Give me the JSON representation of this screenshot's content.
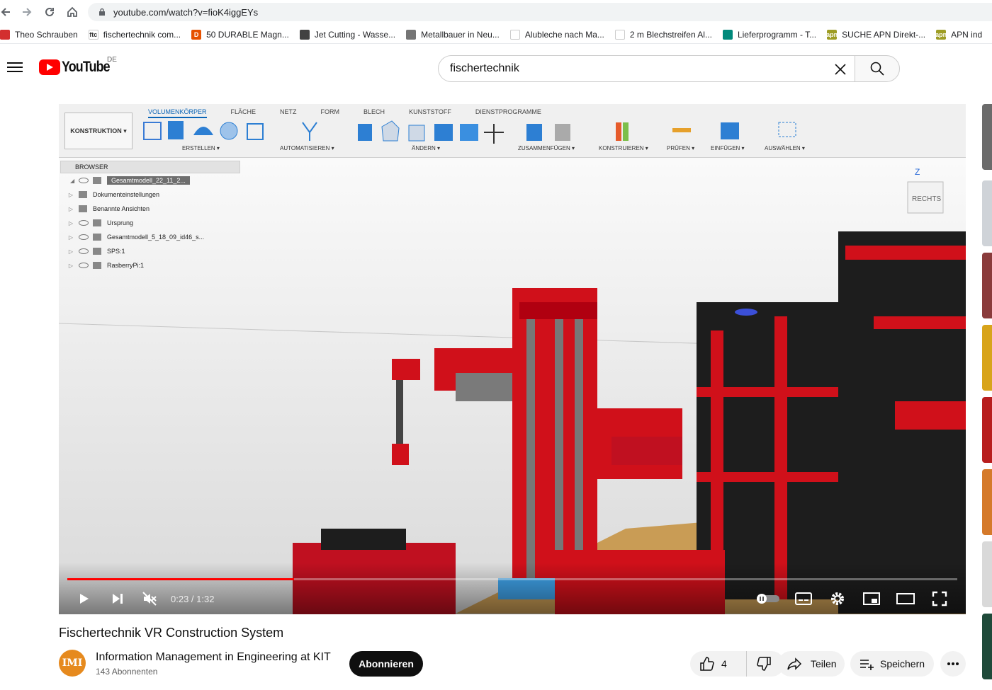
{
  "browser": {
    "url": "youtube.com/watch?v=fioK4iggEYs",
    "bookmarks": [
      {
        "label": "Theo Schrauben",
        "color": "#d32f2f",
        "glyph": ""
      },
      {
        "label": "fischertechnik com...",
        "color": "#ffffff",
        "glyph": "ftc"
      },
      {
        "label": "50 DURABLE Magn...",
        "color": "#e65100",
        "glyph": "D"
      },
      {
        "label": "Jet Cutting - Wasse...",
        "color": "#424242",
        "glyph": ""
      },
      {
        "label": "Metallbauer in Neu...",
        "color": "#757575",
        "glyph": ""
      },
      {
        "label": "Alubleche nach Ma...",
        "color": "#ffffff",
        "glyph": ""
      },
      {
        "label": "2 m Blechstreifen Al...",
        "color": "#ffffff",
        "glyph": ""
      },
      {
        "label": "Lieferprogramm - T...",
        "color": "#00897b",
        "glyph": ""
      },
      {
        "label": "SUCHE APN Direkt-...",
        "color": "#9e9d24",
        "glyph": "apn"
      },
      {
        "label": "APN ind",
        "color": "#9e9d24",
        "glyph": "apn"
      }
    ]
  },
  "header": {
    "logo_text": "YouTube",
    "country": "DE",
    "search_value": "fischertechnik"
  },
  "video": {
    "ribbon_tabs": [
      "VOLUMENKÖRPER",
      "FLÄCHE",
      "NETZ",
      "FORM",
      "BLECH",
      "KUNSTSTOFF",
      "DIENSTPROGRAMME"
    ],
    "mode_button": "KONSTRUKTION ▾",
    "ribbon_groups": [
      "ERSTELLEN ▾",
      "AUTOMATISIEREN ▾",
      "ÄNDERN ▾",
      "ZUSAMMENFÜGEN ▾",
      "KONSTRUIEREN ▾",
      "PRÜFEN ▾",
      "EINFÜGEN ▾",
      "AUSWÄHLEN ▾"
    ],
    "browser_title": "BROWSER",
    "browser_items": [
      "Gesamtmodell_22_11_2...",
      "Dokumenteinstellungen",
      "Benannte Ansichten",
      "Ursprung",
      "Gesamtmodell_5_18_09_id46_s...",
      "SPS:1",
      "RasberryPi:1"
    ],
    "viewcube_label": "RECHTS",
    "viewcube_axis": "Z",
    "time": "0:23 / 1:32",
    "progress": 0.255,
    "title": "Fischertechnik VR Construction System"
  },
  "channel": {
    "name": "Information Management in Engineering at KIT",
    "subs": "143 Abonnenten",
    "avatar_text": "IMI",
    "subscribe_label": "Abonnieren",
    "likes": "4",
    "share_label": "Teilen",
    "save_label": "Speichern"
  },
  "colors": {
    "accent": "#ff0000",
    "machine_red": "#d0101a",
    "machine_black": "#1d1d1d"
  }
}
